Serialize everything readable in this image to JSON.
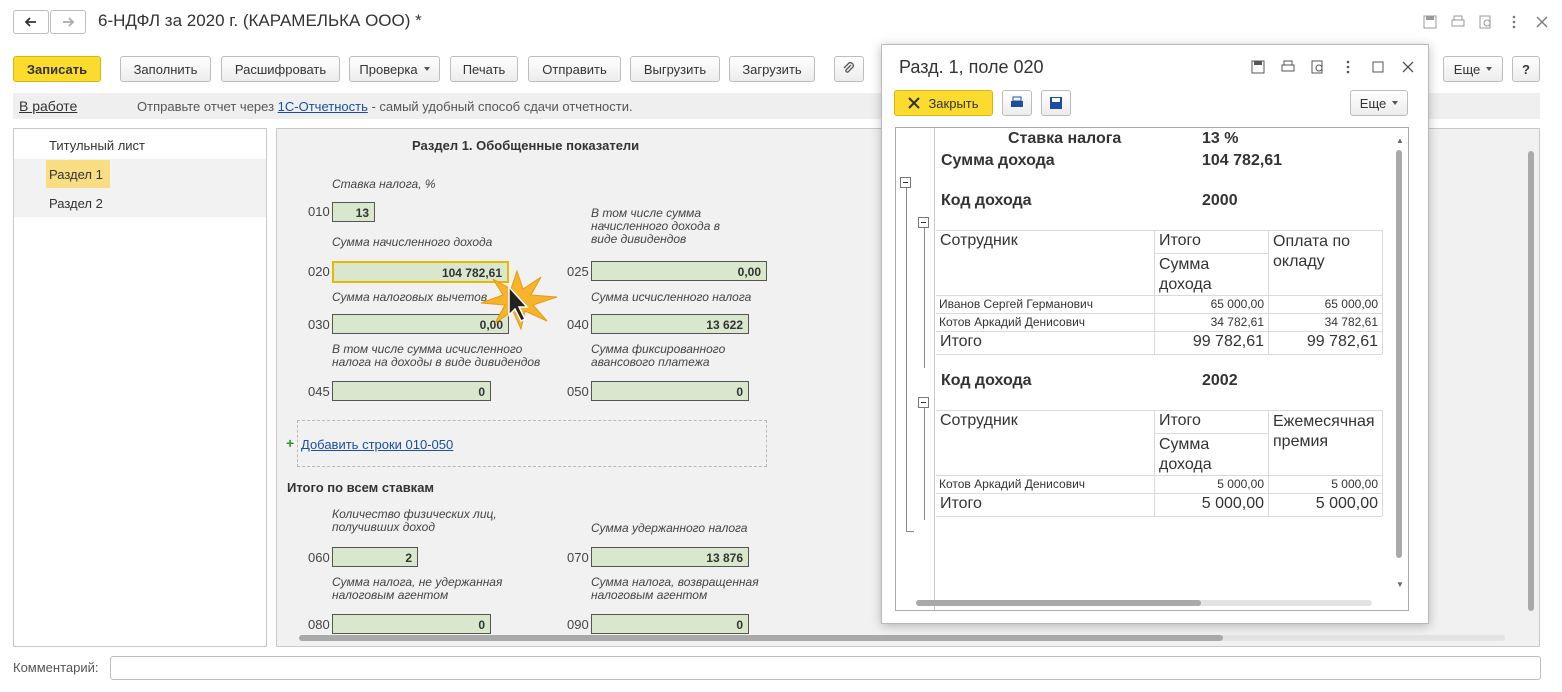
{
  "window": {
    "title": "6-НДФЛ за 2020 г. (КАРАМЕЛЬКА ООО) *"
  },
  "toolbar": {
    "save": "Записать",
    "fill": "Заполнить",
    "decode": "Расшифровать",
    "check": "Проверка",
    "print": "Печать",
    "send": "Отправить",
    "export": "Выгрузить",
    "import": "Загрузить",
    "more": "Еще",
    "help": "?"
  },
  "infobar": {
    "status": "В работе",
    "text_before": "Отправьте отчет через ",
    "link": "1С-Отчетность",
    "text_after": " - самый удобный способ сдачи отчетности."
  },
  "nav": {
    "items": [
      "Титульный лист",
      "Раздел 1",
      "Раздел 2"
    ],
    "selected": "Раздел 1"
  },
  "form": {
    "section_title": "Раздел 1. Обобщенные показатели",
    "rate_label": "Ставка налога, %",
    "f010": {
      "code": "010",
      "value": "13"
    },
    "income_label": "Сумма начисленного дохода",
    "f020": {
      "code": "020",
      "value": "104 782,61"
    },
    "dividends_income_label": "В том числе сумма начисленного дохода в виде дивидендов",
    "f025": {
      "code": "025",
      "value": "0,00"
    },
    "deductions_label": "Сумма налоговых вычетов",
    "f030": {
      "code": "030",
      "value": "0,00"
    },
    "calc_tax_label": "Сумма исчисленного налога",
    "f040": {
      "code": "040",
      "value": "13 622"
    },
    "dividends_tax_label": "В том числе сумма исчисленного налога на доходы в виде дивидендов",
    "f045": {
      "code": "045",
      "value": "0"
    },
    "fixed_advance_label": "Сумма фиксированного авансового платежа",
    "f050": {
      "code": "050",
      "value": "0"
    },
    "add_rows_link": "Добавить строки 010-050",
    "total_title": "Итого по всем ставкам",
    "persons_label": "Количество физических лиц, получивших доход",
    "f060": {
      "code": "060",
      "value": "2"
    },
    "withheld_label": "Сумма удержанного налога",
    "f070": {
      "code": "070",
      "value": "13 876"
    },
    "not_withheld_label": "Сумма налога, не удержанная налоговым агентом",
    "f080": {
      "code": "080",
      "value": "0"
    },
    "returned_label": "Сумма налога, возвращенная налоговым агентом",
    "f090": {
      "code": "090",
      "value": "0"
    }
  },
  "popup": {
    "title": "Разд. 1, поле 020",
    "close": "Закрыть",
    "more": "Еще",
    "report": {
      "rate_label": "Ставка налога",
      "rate_value": "13 %",
      "income_label": "Сумма дохода",
      "income_value": "104 782,61",
      "code_label": "Код дохода",
      "groups": [
        {
          "code": "2000",
          "col_employee": "Сотрудник",
          "col_total": "Итого",
          "col_sum": "Сумма дохода",
          "col_type": "Оплата по окладу",
          "rows": [
            {
              "name": "Иванов Сергей Германович",
              "total": "65 000,00",
              "type": "65 000,00"
            },
            {
              "name": "Котов Аркадий Денисович",
              "total": "34 782,61",
              "type": "34 782,61"
            }
          ],
          "total_label": "Итого",
          "total_total": "99 782,61",
          "total_type": "99 782,61"
        },
        {
          "code": "2002",
          "col_employee": "Сотрудник",
          "col_total": "Итого",
          "col_sum": "Сумма дохода",
          "col_type": "Ежемесячная премия",
          "rows": [
            {
              "name": "Котов Аркадий Денисович",
              "total": "5 000,00",
              "type": "5 000,00"
            }
          ],
          "total_label": "Итого",
          "total_total": "5 000,00",
          "total_type": "5 000,00"
        }
      ]
    }
  },
  "comment": {
    "label": "Комментарий:",
    "value": ""
  }
}
